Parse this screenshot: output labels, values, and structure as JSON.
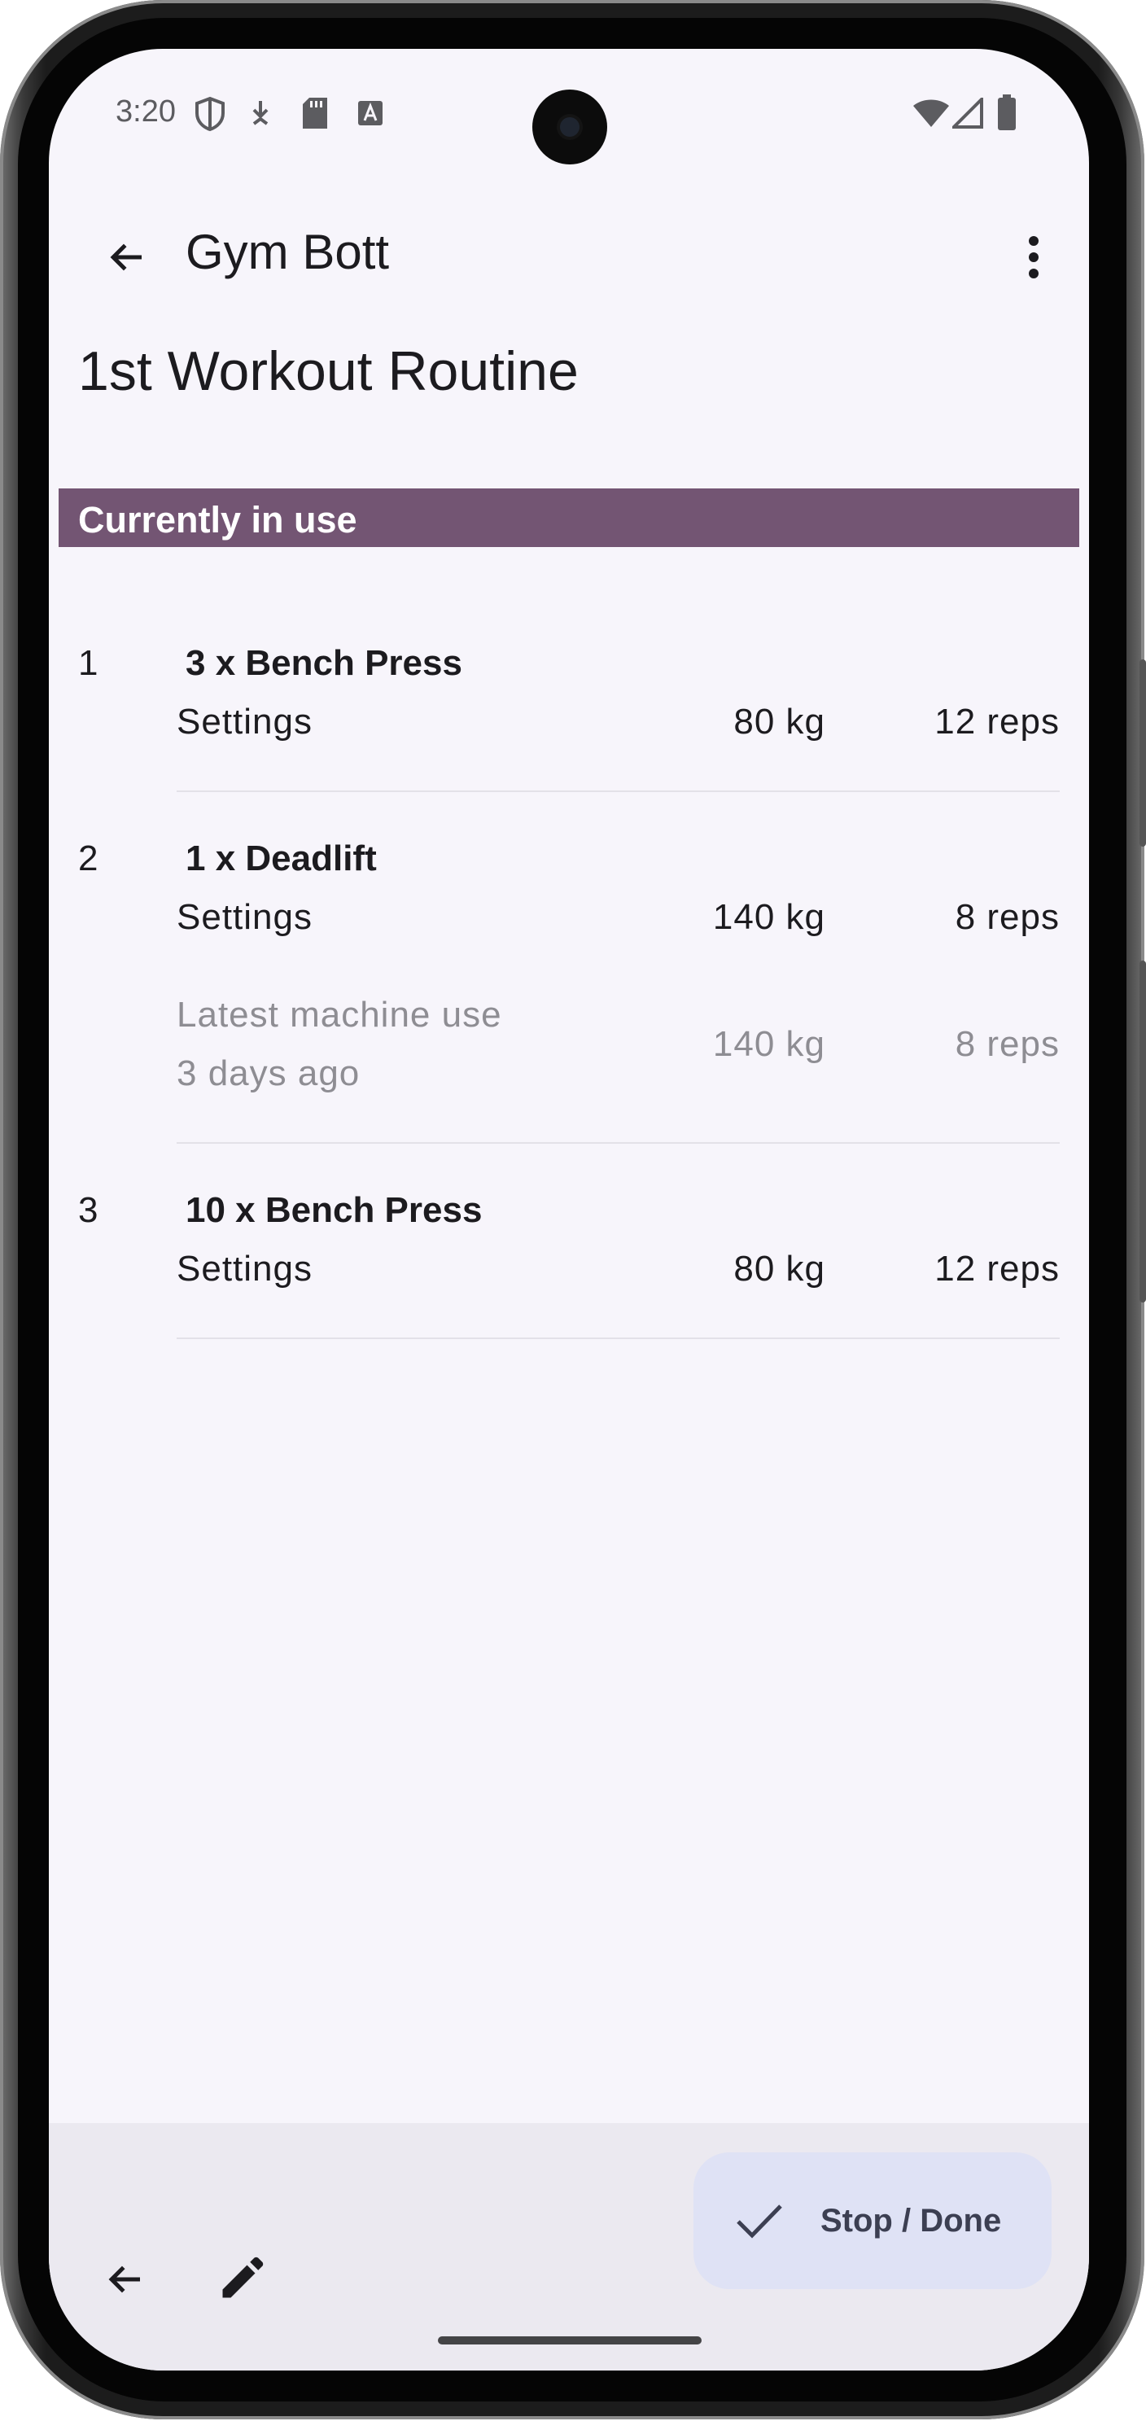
{
  "status_bar": {
    "time": "3:20",
    "left_icons": [
      "shield-icon",
      "download-icon",
      "sd-card-icon",
      "font-icon"
    ],
    "right_icons": [
      "wifi-icon",
      "cell-signal-icon",
      "battery-icon"
    ]
  },
  "app_bar": {
    "title": "Gym Bott",
    "back_icon": "arrow-back-icon",
    "menu_icon": "more-vert-icon"
  },
  "routine": {
    "title": "1st Workout Routine",
    "banner_label": "Currently in use"
  },
  "exercises": [
    {
      "number": "1",
      "name": "3 x Bench Press",
      "settings_label": "Settings",
      "settings_weight": "80 kg",
      "settings_reps": "12 reps"
    },
    {
      "number": "2",
      "name": "1 x Deadlift",
      "settings_label": "Settings",
      "settings_weight": "140 kg",
      "settings_reps": "8 reps",
      "latest_label": "Latest machine use",
      "latest_when": "3 days ago",
      "latest_weight": "140 kg",
      "latest_reps": "8 reps"
    },
    {
      "number": "3",
      "name": "10 x Bench Press",
      "settings_label": "Settings",
      "settings_weight": "80 kg",
      "settings_reps": "12 reps"
    }
  ],
  "bottom_bar": {
    "back_icon": "arrow-back-icon",
    "edit_icon": "pencil-icon",
    "fab_icon": "check-icon",
    "fab_label": "Stop / Done"
  },
  "colors": {
    "banner": "#735573",
    "background": "#f7f5fb",
    "fab": "#dfe2f5",
    "bottom_bar": "#ebe9f0"
  }
}
